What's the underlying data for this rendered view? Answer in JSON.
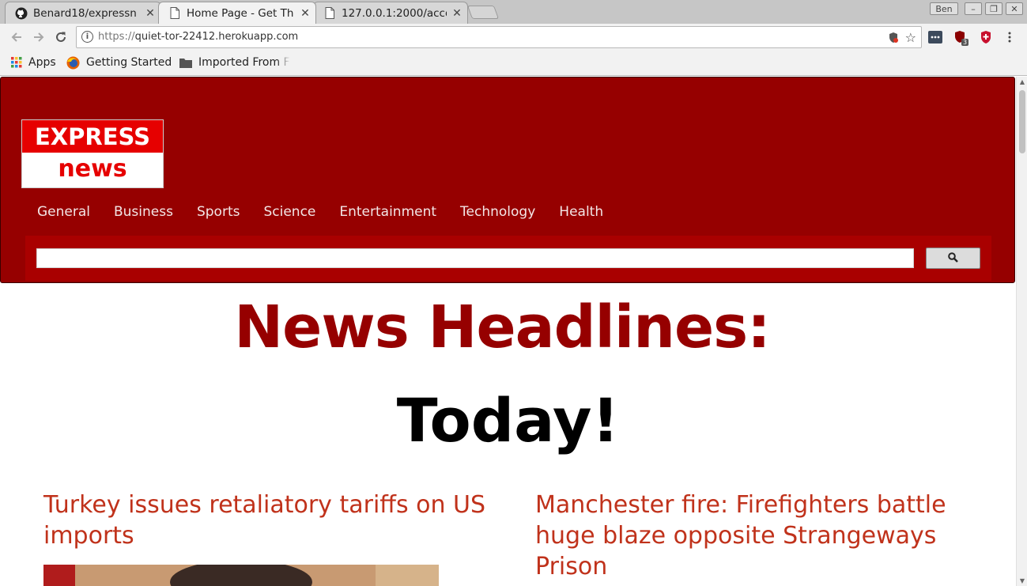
{
  "browser": {
    "tabs": [
      {
        "title": "Benard18/expressn",
        "icon": "github-icon"
      },
      {
        "title": "Home Page - Get Th",
        "icon": "document-icon"
      },
      {
        "title": "127.0.0.1:2000/acco",
        "icon": "document-icon"
      }
    ],
    "user_label": "Ben",
    "address": {
      "scheme": "https://",
      "host": "quiet-tor-22412.herokuapp.com"
    },
    "extension_badge": "3",
    "bookmarks": [
      {
        "label": "Apps",
        "icon": "apps-grid-icon"
      },
      {
        "label": "Getting Started",
        "icon": "firefox-icon"
      },
      {
        "label": "Imported From F",
        "icon": "folder-icon"
      }
    ]
  },
  "site": {
    "logo_top": "EXPRESS",
    "logo_bottom": "news",
    "nav": [
      "General",
      "Business",
      "Sports",
      "Science",
      "Entertainment",
      "Technology",
      "Health"
    ],
    "search_placeholder": ""
  },
  "main": {
    "headline": "News Headlines:",
    "subheadline": "Today!",
    "articles": [
      {
        "title": "Turkey issues retaliatory tariffs on US imports"
      },
      {
        "title": "Manchester fire: Firefighters battle huge blaze opposite Strangeways Prison"
      }
    ]
  },
  "colors": {
    "brand_red": "#960000",
    "article_link": "#c0321b"
  }
}
